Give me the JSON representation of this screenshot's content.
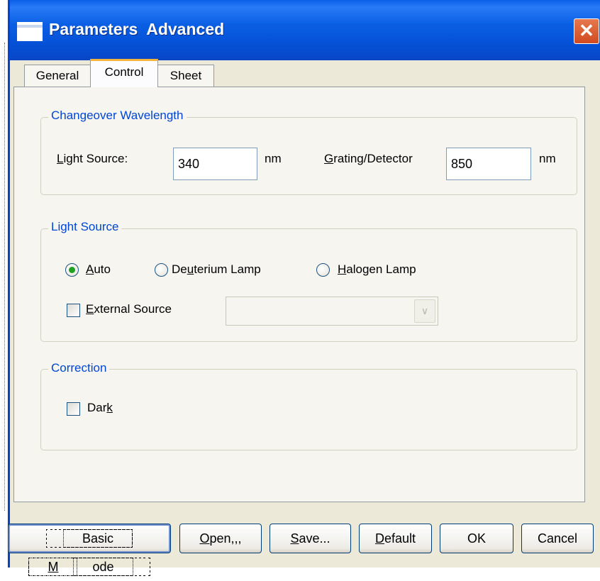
{
  "window": {
    "title": "Parameters  Advanced",
    "close_glyph": "✕"
  },
  "tabs": [
    {
      "label": "General"
    },
    {
      "label": "Control",
      "active": true
    },
    {
      "label": "Sheet"
    }
  ],
  "changeover": {
    "legend": "Changeover Wavelength",
    "light_source": {
      "pre": "",
      "ul": "L",
      "post": "ight Source:",
      "value": "340",
      "unit": "nm"
    },
    "grating": {
      "pre": "",
      "ul": "G",
      "post": "rating/Detector",
      "value": "850",
      "unit": "nm"
    }
  },
  "light_source": {
    "legend": "Light Source",
    "radios": [
      {
        "pre": "",
        "ul": "A",
        "post": "uto",
        "selected": true
      },
      {
        "pre": "De",
        "ul": "u",
        "post": "terium Lamp",
        "selected": false
      },
      {
        "pre": "",
        "ul": "H",
        "post": "alogen Lamp",
        "selected": false
      }
    ],
    "external": {
      "pre": "",
      "ul": "E",
      "post": "xternal Source",
      "checked": false,
      "combo_value": "",
      "combo_icon": "chevron-down-icon"
    }
  },
  "correction": {
    "legend": "Correction",
    "dark": {
      "pre": "Dar",
      "ul": "k",
      "post": "",
      "checked": false
    }
  },
  "buttons": {
    "basic_mode": {
      "pre": "Basic ",
      "ul": "M",
      "post": "ode"
    },
    "open": {
      "pre": "",
      "ul": "O",
      "post": "pen,,,"
    },
    "save": {
      "pre": "",
      "ul": "S",
      "post": "ave..."
    },
    "default": {
      "pre": "",
      "ul": "D",
      "post": "efault"
    },
    "ok": {
      "pre": "OK",
      "ul": "",
      "post": ""
    },
    "cancel": {
      "pre": "Cancel",
      "ul": "",
      "post": ""
    }
  },
  "colors": {
    "title_bar": "#0A5EE8",
    "group_legend": "#0046D5",
    "radio_dot": "#21A121",
    "dialog_face": "#ECE9D8"
  }
}
